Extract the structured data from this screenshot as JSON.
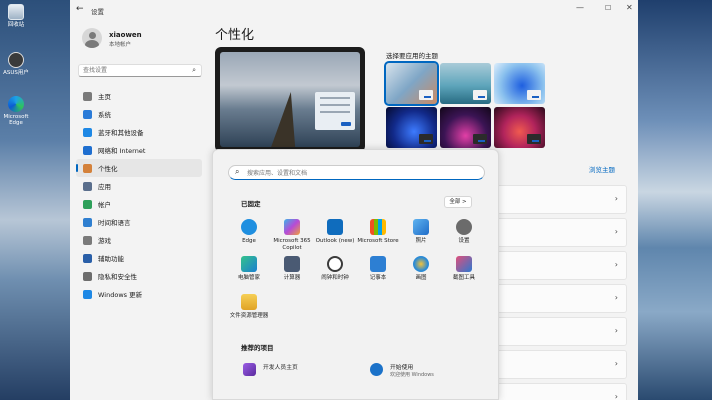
{
  "desktop": {
    "icons": [
      {
        "label": "回收站",
        "icon": "recycle-bin-icon"
      },
      {
        "label": "ASUS用户",
        "icon": "user-icon"
      },
      {
        "label": "Microsoft Edge",
        "icon": "edge-icon"
      }
    ]
  },
  "window": {
    "title": "设置",
    "controls": {
      "min": "—",
      "max": "☐",
      "close": "✕"
    },
    "back": "←"
  },
  "profile": {
    "name": "xiaowen",
    "sub": "本地帐户"
  },
  "search": {
    "placeholder": "查找设置"
  },
  "nav": {
    "items": [
      {
        "label": "主页",
        "color": "#7a7a7a"
      },
      {
        "label": "系统",
        "color": "#2b7bd8"
      },
      {
        "label": "蓝牙和其他设备",
        "color": "#1e88e5"
      },
      {
        "label": "网络和 Internet",
        "color": "#1f6fd0"
      },
      {
        "label": "个性化",
        "color": "#d4813a"
      },
      {
        "label": "应用",
        "color": "#5a6e8c"
      },
      {
        "label": "帐户",
        "color": "#2ea05a"
      },
      {
        "label": "时间和语言",
        "color": "#2f7fd0"
      },
      {
        "label": "游戏",
        "color": "#7a7a7a"
      },
      {
        "label": "辅助功能",
        "color": "#2a5fa8"
      },
      {
        "label": "隐私和安全性",
        "color": "#6d6d6d"
      },
      {
        "label": "Windows 更新",
        "color": "#1e88e5"
      }
    ],
    "active_index": 4
  },
  "main": {
    "title": "个性化",
    "theme_title": "选择要应用的主题",
    "mode_link": "浏览主题"
  },
  "start": {
    "search_placeholder": "搜索应用、设置和文档",
    "pinned_title": "已固定",
    "all_label": "全部 >",
    "apps": [
      {
        "label": "Edge",
        "color": "#1f8fe0",
        "icon": "edge-icon"
      },
      {
        "label": "Microsoft 365 Copilot",
        "color": "#b64bd6",
        "icon": "copilot-icon"
      },
      {
        "label": "Outlook (new)",
        "color": "#0f6cbd",
        "icon": "outlook-icon"
      },
      {
        "label": "Microsoft Store",
        "color": "#2f74d0",
        "icon": "store-icon"
      },
      {
        "label": "照片",
        "color": "#3a8ad8",
        "icon": "photos-icon"
      },
      {
        "label": "设置",
        "color": "#6b6b6b",
        "icon": "settings-icon"
      },
      {
        "label": "电脑管家",
        "color": "#26a36a",
        "icon": "pc-manager-icon"
      },
      {
        "label": "计算器",
        "color": "#4a5a73",
        "icon": "calculator-icon"
      },
      {
        "label": "闹钟和时钟",
        "color": "#3b3b3b",
        "icon": "clock-icon"
      },
      {
        "label": "记事本",
        "color": "#2d7fd3",
        "icon": "notepad-icon"
      },
      {
        "label": "画图",
        "color": "#2b8bd6",
        "icon": "paint-icon"
      },
      {
        "label": "截图工具",
        "color": "#d13c6a",
        "icon": "snipping-tool-icon"
      },
      {
        "label": "文件资源管理器",
        "color": "#e8b530",
        "icon": "folder-icon"
      }
    ],
    "recommended_title": "推荐的项目",
    "recommended": [
      {
        "title": "开发人员主页",
        "sub": "",
        "color": "#7b3fb8",
        "icon": "dev-home-icon"
      },
      {
        "title": "开始使用",
        "sub": "欢迎使用 Windows",
        "color": "#1b72c9",
        "icon": "get-started-icon"
      }
    ]
  }
}
